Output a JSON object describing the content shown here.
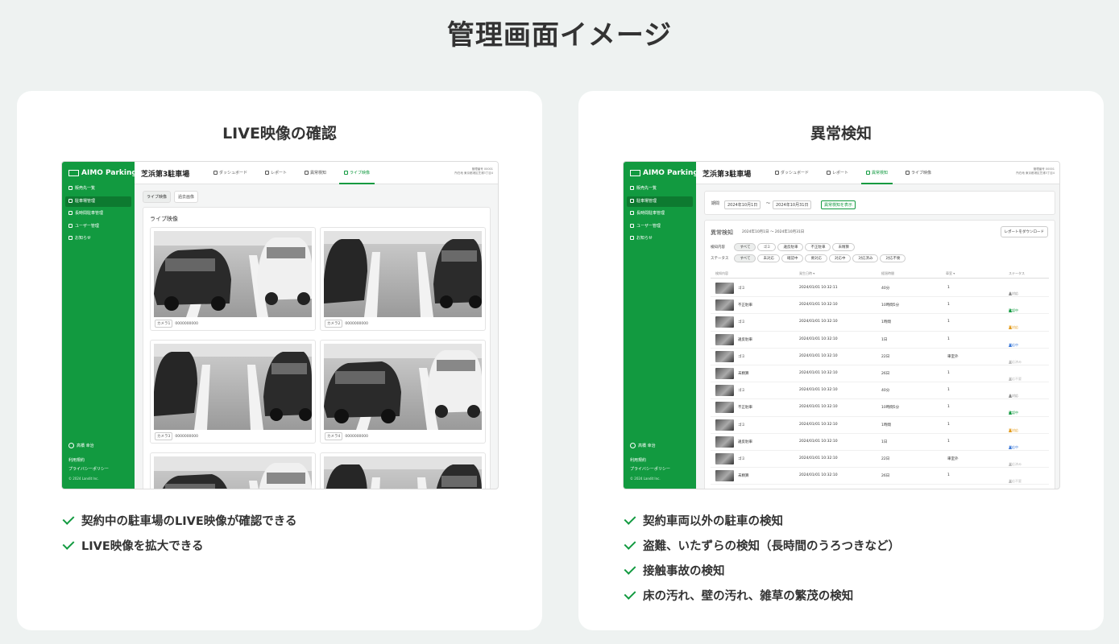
{
  "page_title": "管理画面イメージ",
  "colors": {
    "accent": "#129a40",
    "background": "#eef2f1"
  },
  "cards": [
    {
      "title": "LIVE映像の確認",
      "features": [
        "契約中の駐車場のLIVE映像が確認できる",
        "LIVE映像を拡大できる"
      ]
    },
    {
      "title": "異常検知",
      "features": [
        "契約車両以外の駐車の検知",
        "盗難、いたずらの検知（長時間のうろつきなど）",
        "接触事故の検知",
        "床の汚れ、壁の汚れ、雑草の繁茂の検知"
      ]
    }
  ],
  "app": {
    "logo": "AIMO Parking",
    "lot_name": "芝浜第3駐車場",
    "meta_line1": "管理番号 00001",
    "meta_line2": "所在地 東京都港区芝浦3丁目4",
    "sidebar": [
      "販売先一覧",
      "駐車場管理",
      "長時間駐車管理",
      "ユーザー管理",
      "お知らせ"
    ],
    "user": "高橋 幸治",
    "terms": "利用規約",
    "privacy": "プライバシーポリシー",
    "copyright": "© 2024 Landit Inc.",
    "tabs": [
      "ダッシュボード",
      "レポート",
      "異常検知",
      "ライブ映像"
    ]
  },
  "live": {
    "subtabs": [
      "ライブ映像",
      "過去画像"
    ],
    "panel_title": "ライブ映像",
    "cameras": [
      {
        "name": "カメラ1",
        "id": "0000000000"
      },
      {
        "name": "カメラ2",
        "id": "0000000000"
      },
      {
        "name": "カメラ3",
        "id": "0000000000"
      },
      {
        "name": "カメラ4",
        "id": "0000000000"
      }
    ]
  },
  "anomaly": {
    "period_label": "期間",
    "date_from": "2024年10月1日",
    "date_sep": "〜",
    "date_to": "2024年10月31日",
    "show_button": "異常検知を表示",
    "title": "異常検知",
    "period_text": "2024年10月1日 〜 2024年10月31日",
    "download": "レポートをダウンロード",
    "type_label": "検知内容",
    "type_chips": [
      "すべて",
      "ゴミ",
      "違反駐車",
      "不正駐車",
      "未精算"
    ],
    "status_label": "ステータス",
    "status_chips": [
      "すべて",
      "未対応",
      "確認中",
      "要対応",
      "対応中",
      "対応済み",
      "対応不要"
    ],
    "columns": [
      "検知内容",
      "発生日時 ▾",
      "経過時間",
      "車室 ▾",
      "ステータス"
    ],
    "rows": [
      {
        "type": "ゴミ",
        "time": "2024/01/01 10:32:11",
        "elapsed": "40分",
        "room": "1",
        "status": "未対応",
        "color": "#888888"
      },
      {
        "type": "不正駐車",
        "time": "2024/01/01 10:32:10",
        "elapsed": "10時間5分",
        "room": "1",
        "status": "確認中",
        "color": "#129a40"
      },
      {
        "type": "ゴミ",
        "time": "2024/01/01 10:32:10",
        "elapsed": "1時間",
        "room": "1",
        "status": "要対応",
        "color": "#e39a1a"
      },
      {
        "type": "違反駐車",
        "time": "2024/01/01 10:32:10",
        "elapsed": "1日",
        "room": "1",
        "status": "対応中",
        "color": "#3a78d8"
      },
      {
        "type": "ゴミ",
        "time": "2024/01/01 10:32:10",
        "elapsed": "22日",
        "room": "車室外",
        "status": "対応済み",
        "color": "#bbbbbb"
      },
      {
        "type": "未精算",
        "time": "2024/01/01 10:32:10",
        "elapsed": "26日",
        "room": "1",
        "status": "対応不要",
        "color": "#bbbbbb"
      },
      {
        "type": "ゴミ",
        "time": "2024/01/01 10:32:10",
        "elapsed": "40分",
        "room": "1",
        "status": "未対応",
        "color": "#888888"
      },
      {
        "type": "不正駐車",
        "time": "2024/01/01 10:32:10",
        "elapsed": "10時間5分",
        "room": "1",
        "status": "確認中",
        "color": "#129a40"
      },
      {
        "type": "ゴミ",
        "time": "2024/01/01 10:32:10",
        "elapsed": "1時間",
        "room": "1",
        "status": "要対応",
        "color": "#e39a1a"
      },
      {
        "type": "違反駐車",
        "time": "2024/01/01 10:32:10",
        "elapsed": "1日",
        "room": "1",
        "status": "対応中",
        "color": "#3a78d8"
      },
      {
        "type": "ゴミ",
        "time": "2024/01/01 10:32:10",
        "elapsed": "22日",
        "room": "車室外",
        "status": "対応済み",
        "color": "#bbbbbb"
      },
      {
        "type": "未精算",
        "time": "2024/01/01 10:32:10",
        "elapsed": "26日",
        "room": "1",
        "status": "対応不要",
        "color": "#bbbbbb"
      }
    ]
  }
}
